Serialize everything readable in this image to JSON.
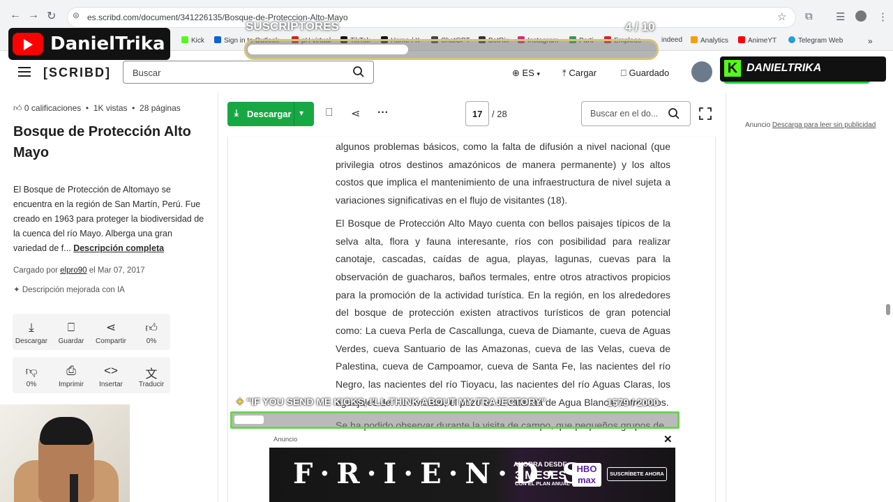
{
  "browser": {
    "url": "es.scribd.com/document/341226135/Bosque-de-Proteccion-Alto-Mayo",
    "bookmarks": [
      "Kick",
      "Sign in to Outlook",
      "pH virtual",
      "TikTok",
      "Home / X",
      "ChatGPT",
      "BotRix",
      "Instagram",
      "Parti",
      "Empleos",
      "indeed",
      "Analytics",
      "AnimeYT",
      "Telegram Web"
    ]
  },
  "overlays": {
    "channel_name": "DanielTrika",
    "subs_label": "SUSCRIPTORES",
    "subs_count": "4 / 10",
    "kick_name": "DANIELTRIKA",
    "comment_text": "\"IF YOU SEND ME KICKS, I'LL THINK ABOUT MY TRAJECTORY\"",
    "comment_count": "1579 / 2000"
  },
  "header": {
    "logo": "[SCRIBD]",
    "search_placeholder": "Buscar",
    "language": "ES",
    "upload_label": "Cargar",
    "saved_label": "Guardado"
  },
  "sidebar": {
    "ratings": "0 calificaciones",
    "views": "1K vistas",
    "pages": "28 páginas",
    "title": "Bosque de Protección Alto Mayo",
    "description": "El Bosque de Protección de Altomayo se encuentra en la región de San Martín, Perú. Fue creado en 1963 para proteger la biodiversidad de la cuenca del río Mayo. Alberga una gran variedad de f...",
    "description_link": "Descripción completa",
    "uploaded_prefix": "Cargado por",
    "uploaded_user": "elpro90",
    "uploaded_date": "el Mar 07, 2017",
    "ai_note": "Descripción mejorada con IA",
    "actions": [
      {
        "label": "Descargar",
        "icon": "download-icon"
      },
      {
        "label": "Guardar",
        "icon": "bookmark-icon"
      },
      {
        "label": "Compartir",
        "icon": "share-icon"
      },
      {
        "label": "0%",
        "icon": "thumbs-up-icon"
      },
      {
        "label": "0%",
        "icon": "thumbs-down-icon"
      },
      {
        "label": "Imprimir",
        "icon": "print-icon"
      },
      {
        "label": "Insertar",
        "icon": "embed-icon"
      },
      {
        "label": "Traducir",
        "icon": "translate-icon"
      }
    ]
  },
  "toolbar": {
    "download_label": "Descargar",
    "current_page": "17",
    "total_pages": "/ 28",
    "doc_search_placeholder": "Buscar en el do..."
  },
  "document": {
    "paragraphs": [
      "algunos problemas básicos, como la falta de difusión a nivel nacional (que privilegia otros destinos amazónicos de manera permanente) y los altos costos que implica el mantenimiento de una infraestructura de nivel sujeta a variaciones significativas en el flujo de visitantes (18).",
      "El Bosque de Protección Alto Mayo cuenta con bellos paisajes típicos de la selva alta, flora y fauna interesante, ríos con posibilidad para realizar canotaje, cascadas, caídas de agua, playas, lagunas, cuevas para la observación de guacharos, baños termales, entre otros atractivos propicios para la promoción de la actividad turística. En la región, en los alrededores del bosque de protección existen atractivos turísticos de gran potencial como: La cueva Perla de Cascallunga, cueva de Diamante, cueva de Aguas Verdes, cueva Santuario de las Amazonas, cueva de las Velas, cueva de Palestina, cueva de Campoamor, cueva de Santa Fe, las nacientes del río Negro, las nacientes del río Tioyacu, las nacientes del río Aguas Claras, los aguajales del río Avisado, el pozo de la catarata de Agua Blanca, entre otros."
    ],
    "partial_line": "Se ha podido observar durante la visita de campo, que pequeños grupos de"
  },
  "right_ad": {
    "label": "Anuncio",
    "link": "Descarga para leer sin publicidad"
  },
  "bottom_ad": {
    "label": "Anuncio",
    "title": "F·R·I·E·N·D·S",
    "promo_line1": "AHORRA DESDE",
    "promo_line2": "3 MESES",
    "promo_line3": "CON EL PLAN ANUAL",
    "brand": "HBO max",
    "cta": "SUSCRÍBETE AHORA"
  },
  "colors": {
    "download_green": "#18a843",
    "youtube_red": "#ff0000",
    "kick_green": "#53fc18"
  }
}
